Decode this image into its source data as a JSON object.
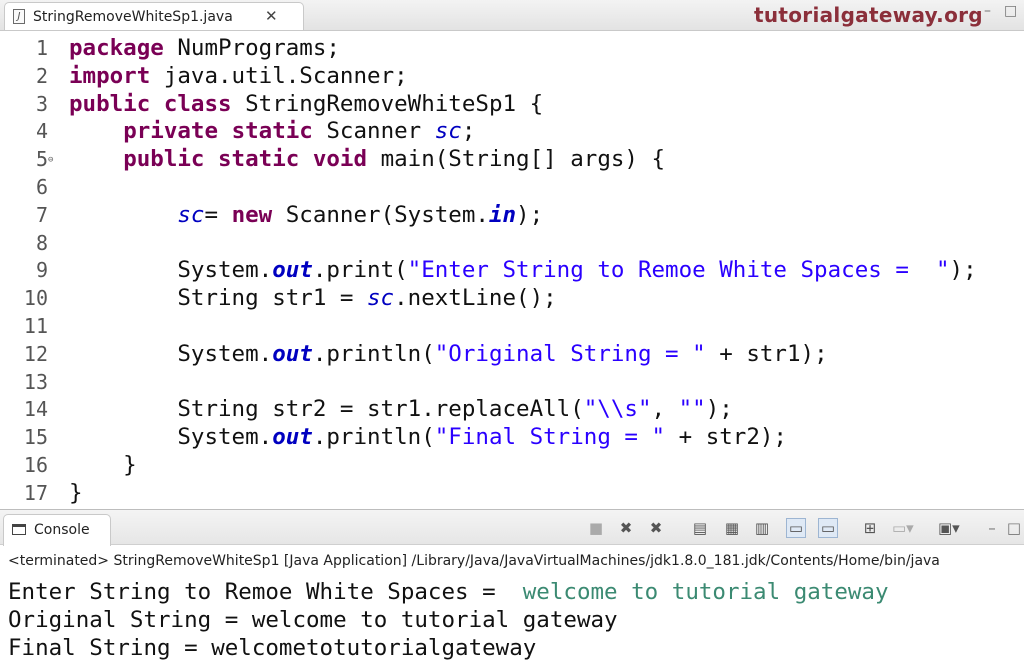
{
  "editor_tab": {
    "title": "StringRemoveWhiteSp1.java",
    "close": "✕",
    "file_icon": "J"
  },
  "watermark": "tutorialgateway.org",
  "window_buttons": {
    "minimize": "–",
    "maximize": "□"
  },
  "code": {
    "line_numbers": [
      "1",
      "2",
      "3",
      "4",
      "5",
      "6",
      "7",
      "8",
      "9",
      "10",
      "11",
      "12",
      "13",
      "14",
      "15",
      "16",
      "17"
    ],
    "fold_marker": "⊖"
  },
  "console": {
    "tab_label": "Console",
    "status": "<terminated> StringRemoveWhiteSp1 [Java Application] /Library/Java/JavaVirtualMachines/jdk1.8.0_181.jdk/Contents/Home/bin/java",
    "output": [
      {
        "prompt": "Enter String to Remoe White Spaces =  ",
        "input": "welcome to tutorial gateway"
      },
      {
        "prompt": "Original String = welcome to tutorial gateway"
      },
      {
        "prompt": "Final String = welcometotutorialgateway"
      }
    ],
    "toolbar_icons": [
      "terminate-icon",
      "remove-launch-icon",
      "remove-all-terminated-icon",
      "clear-console-icon",
      "scroll-lock-icon",
      "word-wrap-icon",
      "show-stdout-icon",
      "show-stderr-icon",
      "pin-console-icon",
      "display-selected-console-icon",
      "open-console-icon",
      "minimize-icon",
      "maximize-icon"
    ]
  }
}
